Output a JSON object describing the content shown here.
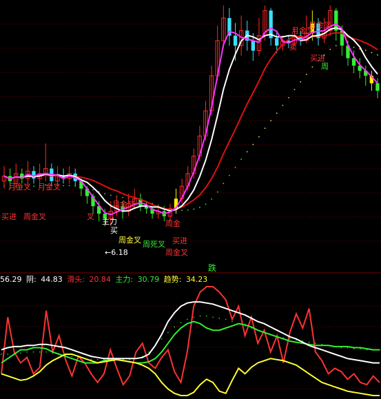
{
  "colors": {
    "background": "#000000",
    "grid": "#7a0000",
    "up_candle": "#ff2a2a",
    "down_candle": "#3ee0ff",
    "green_candle": "#33ee33",
    "yellow_candle": "#ffee00",
    "ma_white": "#ffffff",
    "ma_magenta": "#ff33ff",
    "ma_red": "#dd1111",
    "dots_green": "#33ee33",
    "dots_yellow": "#dddd66",
    "label_red": "#ff3333",
    "label_yellow": "#ffff33",
    "label_white": "#ffffff",
    "label_green": "#33ee33"
  },
  "price_panel": {
    "annotations": [
      {
        "text": "月金叉",
        "color": "label_red"
      },
      {
        "text": "月金叉",
        "color": "label_red"
      },
      {
        "text": "买进",
        "color": "label_red"
      },
      {
        "text": "周金叉",
        "color": "label_red"
      },
      {
        "text": "月金叉",
        "color": "label_red"
      },
      {
        "text": "叉",
        "color": "label_red"
      },
      {
        "text": "主力",
        "color": "label_white"
      },
      {
        "text": "买",
        "color": "label_white"
      },
      {
        "text": "周金叉",
        "color": "label_yellow"
      },
      {
        "text": "周死叉",
        "color": "label_green"
      },
      {
        "text": "周金",
        "color": "label_red"
      },
      {
        "text": "买进",
        "color": "label_red"
      },
      {
        "text": "周金叉",
        "color": "label_red"
      },
      {
        "text": "月金叉",
        "color": "label_red"
      },
      {
        "text": "月金叉",
        "color": "label_red"
      },
      {
        "text": "卖",
        "color": "label_red"
      },
      {
        "text": "买进",
        "color": "label_red"
      },
      {
        "text": "周",
        "color": "label_green"
      },
      {
        "text": "←6.18",
        "color": "label_white"
      }
    ],
    "marker": {
      "text": "跌",
      "color": "label_green"
    }
  },
  "indicator_panel": {
    "readout": [
      {
        "label": "",
        "value": "56.29",
        "color": "label_white"
      },
      {
        "label": "阴: ",
        "value": "44.83",
        "color": "label_white"
      },
      {
        "label": "滑头: ",
        "value": "20.84",
        "color": "label_red"
      },
      {
        "label": "主力: ",
        "value": "30.79",
        "color": "label_green"
      },
      {
        "label": "趋势: ",
        "value": "34.23",
        "color": "label_yellow"
      }
    ]
  },
  "chart_data": [
    {
      "type": "candlestick",
      "title": "",
      "series_note": "price panel with moving averages",
      "low_marker": "6.18",
      "candles": [
        {
          "o": 0.3,
          "c": 0.32,
          "h": 0.36,
          "l": 0.27
        },
        {
          "o": 0.32,
          "c": 0.3,
          "h": 0.35,
          "l": 0.28
        },
        {
          "o": 0.29,
          "c": 0.33,
          "h": 0.37,
          "l": 0.27
        },
        {
          "o": 0.33,
          "c": 0.31,
          "h": 0.35,
          "l": 0.29
        },
        {
          "o": 0.31,
          "c": 0.34,
          "h": 0.38,
          "l": 0.29
        },
        {
          "o": 0.34,
          "c": 0.31,
          "h": 0.36,
          "l": 0.29
        },
        {
          "o": 0.31,
          "c": 0.33,
          "h": 0.37,
          "l": 0.29
        },
        {
          "o": 0.33,
          "c": 0.35,
          "h": 0.45,
          "l": 0.3
        },
        {
          "o": 0.35,
          "c": 0.3,
          "h": 0.37,
          "l": 0.28
        },
        {
          "o": 0.3,
          "c": 0.32,
          "h": 0.36,
          "l": 0.28
        },
        {
          "o": 0.32,
          "c": 0.31,
          "h": 0.35,
          "l": 0.29
        },
        {
          "o": 0.31,
          "c": 0.33,
          "h": 0.36,
          "l": 0.29
        },
        {
          "o": 0.33,
          "c": 0.3,
          "h": 0.35,
          "l": 0.28
        },
        {
          "o": 0.3,
          "c": 0.27,
          "h": 0.31,
          "l": 0.24
        },
        {
          "o": 0.27,
          "c": 0.24,
          "h": 0.28,
          "l": 0.21
        },
        {
          "o": 0.24,
          "c": 0.2,
          "h": 0.25,
          "l": 0.17
        },
        {
          "o": 0.2,
          "c": 0.17,
          "h": 0.22,
          "l": 0.14
        },
        {
          "o": 0.17,
          "c": 0.15,
          "h": 0.19,
          "l": 0.12
        },
        {
          "o": 0.15,
          "c": 0.18,
          "h": 0.22,
          "l": 0.12
        },
        {
          "o": 0.18,
          "c": 0.2,
          "h": 0.24,
          "l": 0.16
        },
        {
          "o": 0.2,
          "c": 0.18,
          "h": 0.22,
          "l": 0.15
        },
        {
          "o": 0.18,
          "c": 0.21,
          "h": 0.25,
          "l": 0.16
        },
        {
          "o": 0.21,
          "c": 0.23,
          "h": 0.27,
          "l": 0.19
        },
        {
          "o": 0.23,
          "c": 0.2,
          "h": 0.25,
          "l": 0.18
        },
        {
          "o": 0.2,
          "c": 0.19,
          "h": 0.22,
          "l": 0.17
        },
        {
          "o": 0.19,
          "c": 0.17,
          "h": 0.2,
          "l": 0.15
        },
        {
          "o": 0.17,
          "c": 0.18,
          "h": 0.2,
          "l": 0.15
        },
        {
          "o": 0.18,
          "c": 0.16,
          "h": 0.19,
          "l": 0.14
        },
        {
          "o": 0.16,
          "c": 0.19,
          "h": 0.21,
          "l": 0.14
        },
        {
          "o": 0.19,
          "c": 0.23,
          "h": 0.27,
          "l": 0.17
        },
        {
          "o": 0.23,
          "c": 0.28,
          "h": 0.31,
          "l": 0.21
        },
        {
          "o": 0.28,
          "c": 0.33,
          "h": 0.36,
          "l": 0.26
        },
        {
          "o": 0.33,
          "c": 0.4,
          "h": 0.43,
          "l": 0.31
        },
        {
          "o": 0.4,
          "c": 0.48,
          "h": 0.52,
          "l": 0.38
        },
        {
          "o": 0.48,
          "c": 0.58,
          "h": 0.62,
          "l": 0.46
        },
        {
          "o": 0.58,
          "c": 0.72,
          "h": 0.76,
          "l": 0.56
        },
        {
          "o": 0.72,
          "c": 0.86,
          "h": 0.92,
          "l": 0.7
        },
        {
          "o": 0.86,
          "c": 0.95,
          "h": 1.0,
          "l": 0.83
        },
        {
          "o": 0.95,
          "c": 0.88,
          "h": 0.99,
          "l": 0.84
        },
        {
          "o": 0.88,
          "c": 0.84,
          "h": 0.93,
          "l": 0.78
        },
        {
          "o": 0.84,
          "c": 0.9,
          "h": 0.96,
          "l": 0.8
        },
        {
          "o": 0.9,
          "c": 0.86,
          "h": 0.94,
          "l": 0.82
        },
        {
          "o": 0.86,
          "c": 0.82,
          "h": 0.89,
          "l": 0.78
        },
        {
          "o": 0.82,
          "c": 0.88,
          "h": 0.95,
          "l": 0.8
        },
        {
          "o": 0.88,
          "c": 0.98,
          "h": 1.0,
          "l": 0.86
        },
        {
          "o": 0.98,
          "c": 0.87,
          "h": 0.99,
          "l": 0.84
        },
        {
          "o": 0.87,
          "c": 0.84,
          "h": 0.9,
          "l": 0.81
        },
        {
          "o": 0.84,
          "c": 0.86,
          "h": 0.88,
          "l": 0.82
        },
        {
          "o": 0.86,
          "c": 0.85,
          "h": 0.88,
          "l": 0.83
        },
        {
          "o": 0.85,
          "c": 0.88,
          "h": 0.91,
          "l": 0.84
        },
        {
          "o": 0.88,
          "c": 0.86,
          "h": 0.9,
          "l": 0.84
        },
        {
          "o": 0.86,
          "c": 0.89,
          "h": 0.96,
          "l": 0.85
        },
        {
          "o": 0.89,
          "c": 0.93,
          "h": 0.98,
          "l": 0.86
        },
        {
          "o": 0.93,
          "c": 0.87,
          "h": 0.95,
          "l": 0.84
        },
        {
          "o": 0.87,
          "c": 0.9,
          "h": 0.95,
          "l": 0.85
        },
        {
          "o": 0.9,
          "c": 0.98,
          "h": 1.0,
          "l": 0.88
        },
        {
          "o": 0.98,
          "c": 0.9,
          "h": 0.99,
          "l": 0.86
        },
        {
          "o": 0.9,
          "c": 0.84,
          "h": 0.92,
          "l": 0.8
        },
        {
          "o": 0.84,
          "c": 0.79,
          "h": 0.86,
          "l": 0.76
        },
        {
          "o": 0.79,
          "c": 0.76,
          "h": 0.82,
          "l": 0.73
        },
        {
          "o": 0.76,
          "c": 0.74,
          "h": 0.79,
          "l": 0.71
        },
        {
          "o": 0.74,
          "c": 0.72,
          "h": 0.76,
          "l": 0.68
        },
        {
          "o": 0.72,
          "c": 0.69,
          "h": 0.74,
          "l": 0.66
        },
        {
          "o": 0.69,
          "c": 0.66,
          "h": 0.71,
          "l": 0.63
        }
      ]
    },
    {
      "type": "line",
      "title": "",
      "series_note": "indicator panel",
      "series": [
        {
          "name": "滑头",
          "color": "label_red",
          "values": [
            20,
            72,
            40,
            30,
            35,
            20,
            26,
            78,
            40,
            55,
            33,
            18,
            36,
            30,
            20,
            12,
            20,
            42,
            25,
            10,
            18,
            40,
            48,
            30,
            25,
            35,
            42,
            22,
            12,
            40,
            82,
            95,
            100,
            100,
            95,
            88,
            70,
            82,
            55,
            72,
            48,
            60,
            40,
            55,
            30,
            58,
            75,
            62,
            80,
            40,
            32,
            20,
            25,
            22,
            15,
            20,
            12,
            10,
            18,
            12
          ]
        },
        {
          "name": "主力",
          "color": "label_green",
          "values": [
            30,
            34,
            38,
            42,
            42,
            44,
            44,
            43,
            40,
            38,
            36,
            34,
            32,
            30,
            30,
            30,
            32,
            33,
            33,
            32,
            31,
            30,
            30,
            31,
            34,
            40,
            48,
            56,
            62,
            66,
            68,
            66,
            62,
            60,
            60,
            62,
            64,
            66,
            65,
            63,
            60,
            58,
            56,
            54,
            52,
            50,
            49,
            48,
            47,
            46,
            46,
            46,
            45,
            45,
            45,
            44,
            44,
            43,
            42,
            42
          ]
        },
        {
          "name": "",
          "color": "ma_white",
          "values": [
            42,
            44,
            45,
            45,
            46,
            46,
            47,
            47,
            46,
            45,
            44,
            42,
            40,
            38,
            36,
            35,
            34,
            34,
            34,
            34,
            34,
            34,
            35,
            38,
            46,
            56,
            68,
            76,
            82,
            85,
            86,
            86,
            85,
            84,
            82,
            80,
            78,
            76,
            74,
            71,
            68,
            66,
            63,
            60,
            57,
            54,
            52,
            49,
            46,
            44,
            42,
            40,
            38,
            36,
            34,
            33,
            32,
            31,
            30,
            30
          ]
        },
        {
          "name": "趋势",
          "color": "label_yellow",
          "values": [
            20,
            18,
            16,
            14,
            15,
            18,
            22,
            28,
            32,
            35,
            38,
            38,
            36,
            34,
            32,
            30,
            31,
            32,
            33,
            32,
            31,
            30,
            28,
            25,
            20,
            12,
            6,
            2,
            0,
            0,
            3,
            10,
            15,
            12,
            4,
            2,
            14,
            25,
            20,
            26,
            30,
            32,
            34,
            33,
            32,
            30,
            28,
            24,
            20,
            16,
            12,
            10,
            8,
            6,
            4,
            3,
            2,
            1,
            0,
            0
          ]
        }
      ],
      "dotted_series": [
        {
          "name": "",
          "color": "dots_green",
          "values": [
            38,
            38,
            39,
            39,
            40,
            40,
            40,
            40,
            39,
            38,
            37,
            36,
            35,
            34,
            33,
            33,
            33,
            33,
            33,
            33,
            33,
            34,
            36,
            40,
            46,
            52,
            58,
            63,
            67,
            70,
            72,
            73,
            73,
            72,
            71,
            70,
            68,
            66,
            64,
            62,
            60,
            58,
            56,
            54,
            53,
            52,
            51,
            50,
            49,
            48,
            47,
            46,
            45,
            44,
            44,
            43,
            43,
            42,
            42,
            42
          ]
        }
      ]
    }
  ]
}
